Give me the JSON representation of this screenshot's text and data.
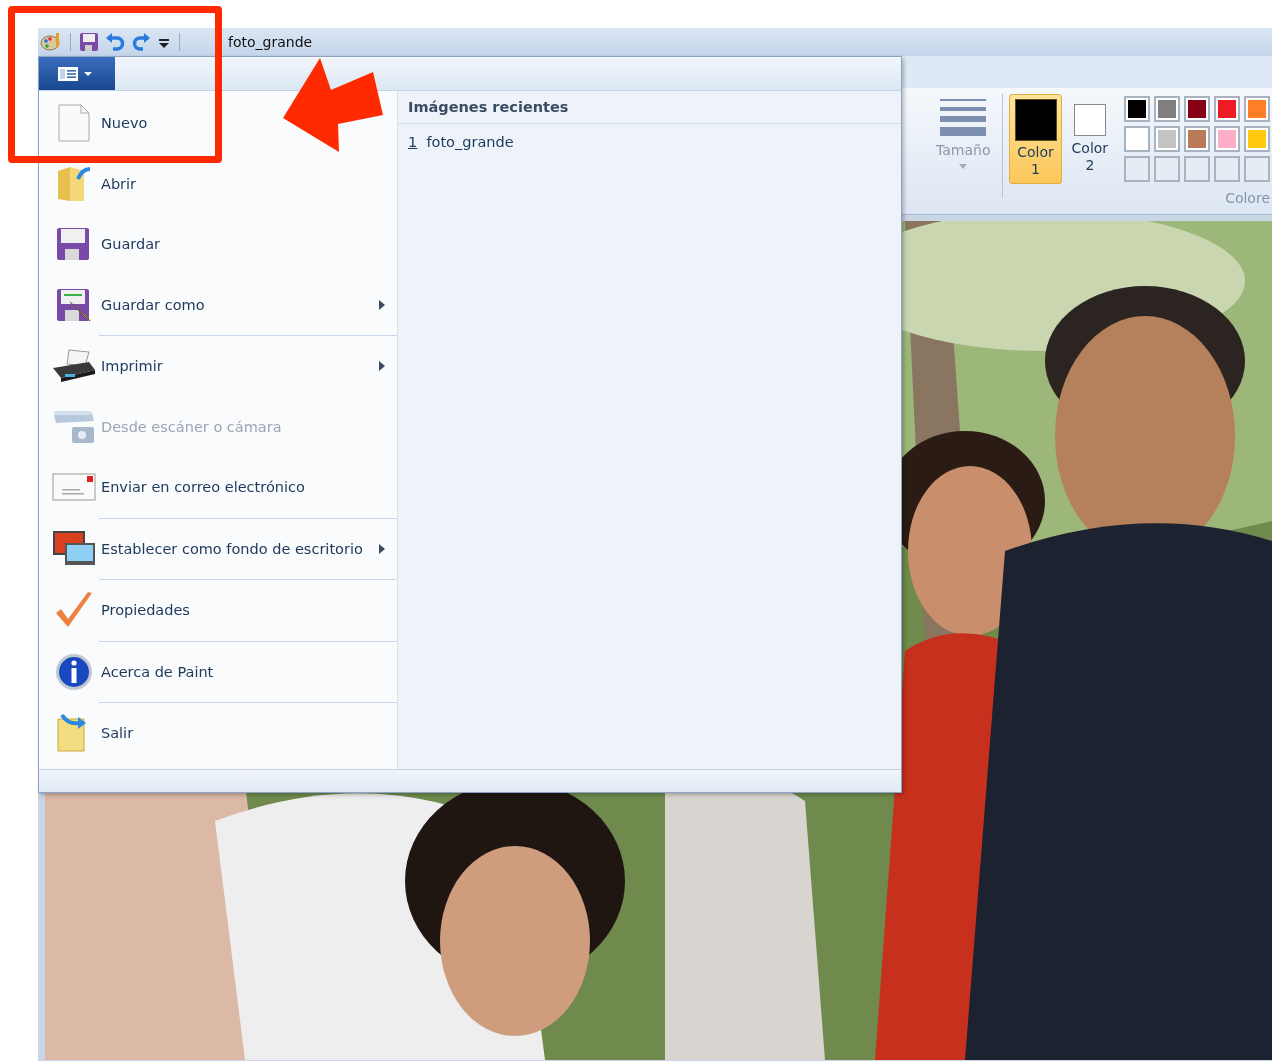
{
  "window": {
    "title": "foto_grande"
  },
  "ribbon": {
    "size": {
      "label": "Tamaño",
      "disabled": true
    },
    "colors": [
      {
        "label": "Color",
        "number": "1",
        "color": "#000000",
        "selected": true
      },
      {
        "label": "Color",
        "number": "2",
        "color": "#ffffff",
        "selected": false
      }
    ],
    "palette": [
      {
        "color": "#000000"
      },
      {
        "color": "#7f7f7f"
      },
      {
        "color": "#880015"
      },
      {
        "color": "#ed1c24"
      },
      {
        "color": "#ff7f27"
      },
      {
        "color": "#ffffff"
      },
      {
        "color": "#c3c3c3"
      },
      {
        "color": "#b97a57"
      },
      {
        "color": "#ffaec9"
      },
      {
        "color": "#ffc90e"
      }
    ],
    "group_label": "Colore"
  },
  "file_menu": {
    "items": [
      {
        "label": "Nuevo",
        "submenu": false,
        "disabled": false,
        "separator_before": false
      },
      {
        "label": "Abrir",
        "submenu": false,
        "disabled": false,
        "separator_before": false
      },
      {
        "label": "Guardar",
        "submenu": false,
        "disabled": false,
        "separator_before": false
      },
      {
        "label": "Guardar como",
        "submenu": true,
        "disabled": false,
        "separator_before": false
      },
      {
        "label": "Imprimir",
        "submenu": true,
        "disabled": false,
        "separator_before": true
      },
      {
        "label": "Desde escáner o cámara",
        "submenu": false,
        "disabled": true,
        "separator_before": false
      },
      {
        "label": "Enviar en correo electrónico",
        "submenu": false,
        "disabled": false,
        "separator_before": false
      },
      {
        "label": "Establecer como fondo de escritorio",
        "submenu": true,
        "disabled": false,
        "separator_before": true
      },
      {
        "label": "Propiedades",
        "submenu": false,
        "disabled": false,
        "separator_before": true
      },
      {
        "label": "Acerca de Paint",
        "submenu": false,
        "disabled": false,
        "separator_before": true
      },
      {
        "label": "Salir",
        "submenu": false,
        "disabled": false,
        "separator_before": true
      }
    ],
    "recent": {
      "heading": "Imágenes recientes",
      "files": [
        {
          "number": "1",
          "name": "foto_grande"
        }
      ]
    }
  }
}
